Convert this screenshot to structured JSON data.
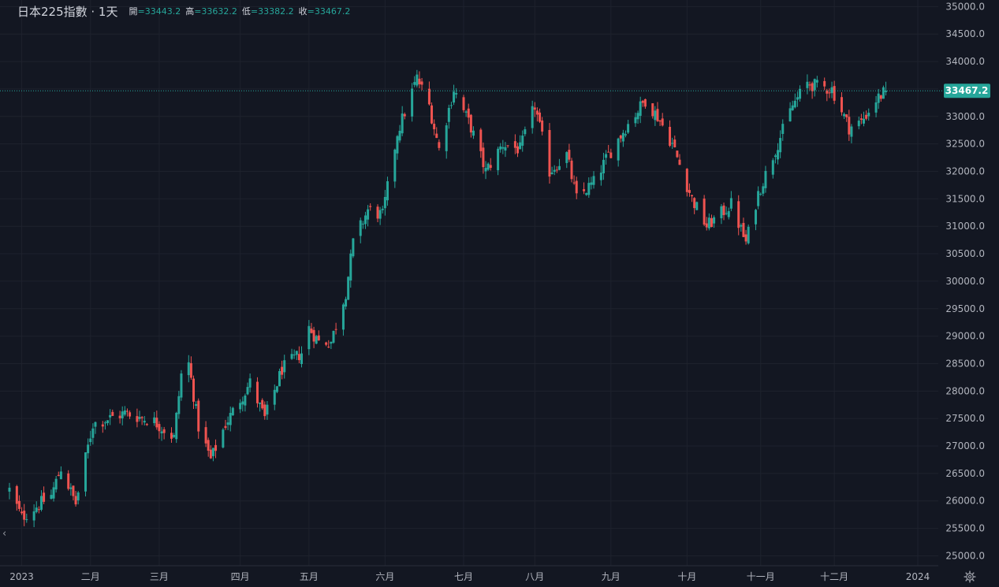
{
  "legend": {
    "title": "日本225指數 · 1天",
    "open_label": "開",
    "open_value": "=33443.2",
    "high_label": "高",
    "high_value": "=33632.2",
    "low_label": "低",
    "low_value": "=33382.2",
    "close_label": "收",
    "close_value": "=33467.2"
  },
  "price_tag": "33467.2",
  "nav": {
    "collapse_glyph": "‹"
  },
  "icons": {
    "settings": "gear-icon"
  },
  "colors": {
    "background": "#131722",
    "up": "#26a69a",
    "down": "#ef5350",
    "grid": "#1e222d",
    "text": "#b2b5be"
  },
  "chart_data": {
    "type": "candlestick",
    "symbol": "日本225指數",
    "interval": "1天",
    "y_ticks": [
      25000,
      25500,
      26000,
      26500,
      27000,
      27500,
      28000,
      28500,
      29000,
      29500,
      30000,
      30500,
      31000,
      31500,
      32000,
      32500,
      33000,
      33500,
      34000,
      34500,
      35000
    ],
    "y_tick_labels": [
      "25000.0",
      "25500.0",
      "26000.0",
      "26500.0",
      "27000.0",
      "27500.0",
      "28000.0",
      "28500.0",
      "29000.0",
      "29500.0",
      "30000.0",
      "30500.0",
      "31000.0",
      "31500.0",
      "32000.0",
      "32500.0",
      "33000.0",
      "33500.0",
      "34000.0",
      "34500.0",
      "35000.0"
    ],
    "ylim": [
      24820,
      35120
    ],
    "x_ticks": [
      {
        "label": "2023",
        "date": "2023-01-04"
      },
      {
        "label": "二月",
        "date": "2023-02-01"
      },
      {
        "label": "三月",
        "date": "2023-03-01"
      },
      {
        "label": "四月",
        "date": "2023-04-03"
      },
      {
        "label": "五月",
        "date": "2023-05-01"
      },
      {
        "label": "六月",
        "date": "2023-06-01"
      },
      {
        "label": "七月",
        "date": "2023-07-03"
      },
      {
        "label": "八月",
        "date": "2023-08-01"
      },
      {
        "label": "九月",
        "date": "2023-09-01"
      },
      {
        "label": "十月",
        "date": "2023-10-02"
      },
      {
        "label": "十一月",
        "date": "2023-11-01"
      },
      {
        "label": "十二月",
        "date": "2023-12-01"
      },
      {
        "label": "2024",
        "date": "2024-01-04"
      }
    ],
    "x_range": [
      "2022-12-30",
      "2024-01-04"
    ],
    "last_price": 33467.2,
    "close_path": [
      [
        "2022-12-30",
        26200
      ],
      [
        "2023-01-04",
        25700
      ],
      [
        "2023-01-16",
        26100
      ],
      [
        "2023-01-20",
        26600
      ],
      [
        "2023-01-26",
        25950
      ],
      [
        "2023-02-02",
        27400
      ],
      [
        "2023-02-15",
        27600
      ],
      [
        "2023-02-27",
        27450
      ],
      [
        "2023-03-07",
        27150
      ],
      [
        "2023-03-10",
        28300
      ],
      [
        "2023-03-13",
        28500
      ],
      [
        "2023-03-17",
        27350
      ],
      [
        "2023-03-22",
        26750
      ],
      [
        "2023-03-28",
        27400
      ],
      [
        "2023-04-07",
        28150
      ],
      [
        "2023-04-13",
        27500
      ],
      [
        "2023-04-20",
        28400
      ],
      [
        "2023-04-28",
        28700
      ],
      [
        "2023-05-01",
        29150
      ],
      [
        "2023-05-05",
        28900
      ],
      [
        "2023-05-10",
        28900
      ],
      [
        "2023-05-16",
        29800
      ],
      [
        "2023-05-19",
        30700
      ],
      [
        "2023-05-25",
        31300
      ],
      [
        "2023-05-31",
        31200
      ],
      [
        "2023-06-06",
        32700
      ],
      [
        "2023-06-14",
        33700
      ],
      [
        "2023-06-19",
        33200
      ],
      [
        "2023-06-23",
        32400
      ],
      [
        "2023-06-29",
        33500
      ],
      [
        "2023-07-06",
        32800
      ],
      [
        "2023-07-12",
        32000
      ],
      [
        "2023-07-19",
        32500
      ],
      [
        "2023-07-26",
        32400
      ],
      [
        "2023-08-01",
        33200
      ],
      [
        "2023-08-07",
        32000
      ],
      [
        "2023-08-14",
        32300
      ],
      [
        "2023-08-18",
        31500
      ],
      [
        "2023-08-25",
        31800
      ],
      [
        "2023-08-31",
        32300
      ],
      [
        "2023-09-07",
        32800
      ],
      [
        "2023-09-15",
        33300
      ],
      [
        "2023-09-20",
        33000
      ],
      [
        "2023-09-26",
        32500
      ],
      [
        "2023-10-04",
        31500
      ],
      [
        "2023-10-10",
        31000
      ],
      [
        "2023-10-20",
        31400
      ],
      [
        "2023-10-26",
        30700
      ],
      [
        "2023-10-31",
        31600
      ],
      [
        "2023-11-07",
        32400
      ],
      [
        "2023-11-14",
        33200
      ],
      [
        "2023-11-20",
        33600
      ],
      [
        "2023-11-24",
        33550
      ],
      [
        "2023-11-30",
        33500
      ],
      [
        "2023-12-07",
        32800
      ],
      [
        "2023-12-12",
        32900
      ],
      [
        "2023-12-18",
        33300
      ],
      [
        "2023-12-22",
        33467.2
      ]
    ]
  }
}
